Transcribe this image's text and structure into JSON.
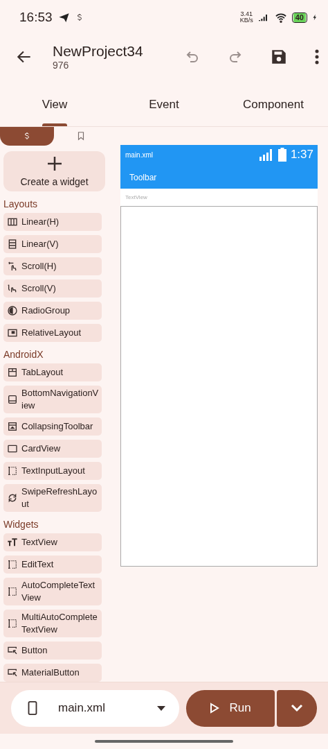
{
  "status_bar": {
    "time": "16:53",
    "speed_value": "3.41",
    "speed_unit": "KB/s",
    "battery": "40"
  },
  "app_bar": {
    "title": "NewProject34",
    "subtitle": "976",
    "undo_disabled": true,
    "redo_disabled": true
  },
  "tabs": [
    {
      "label": "View",
      "selected": true
    },
    {
      "label": "Event",
      "selected": false
    },
    {
      "label": "Component",
      "selected": false
    }
  ],
  "palette_tabs": [
    {
      "selected": true
    },
    {
      "selected": false
    }
  ],
  "create_widget": {
    "label": "Create a widget"
  },
  "sections": [
    {
      "title": "Layouts",
      "items": [
        "Linear(H)",
        "Linear(V)",
        "Scroll(H)",
        "Scroll(V)",
        "RadioGroup",
        "RelativeLayout"
      ]
    },
    {
      "title": "AndroidX",
      "items": [
        "TabLayout",
        "BottomNavigationView",
        "CollapsingToolbar",
        "CardView",
        "TextInputLayout",
        "SwipeRefreshLayout"
      ]
    },
    {
      "title": "Widgets",
      "items": [
        "TextView",
        "EditText",
        "AutoCompleteTextView",
        "MultiAutoCompleteTextView",
        "Button",
        "MaterialButton"
      ]
    }
  ],
  "preview": {
    "file": "main.xml",
    "clock": "1:37",
    "toolbar": "Toolbar",
    "textview": "TextView"
  },
  "bottom_bar": {
    "file": "main.xml",
    "run": "Run"
  }
}
